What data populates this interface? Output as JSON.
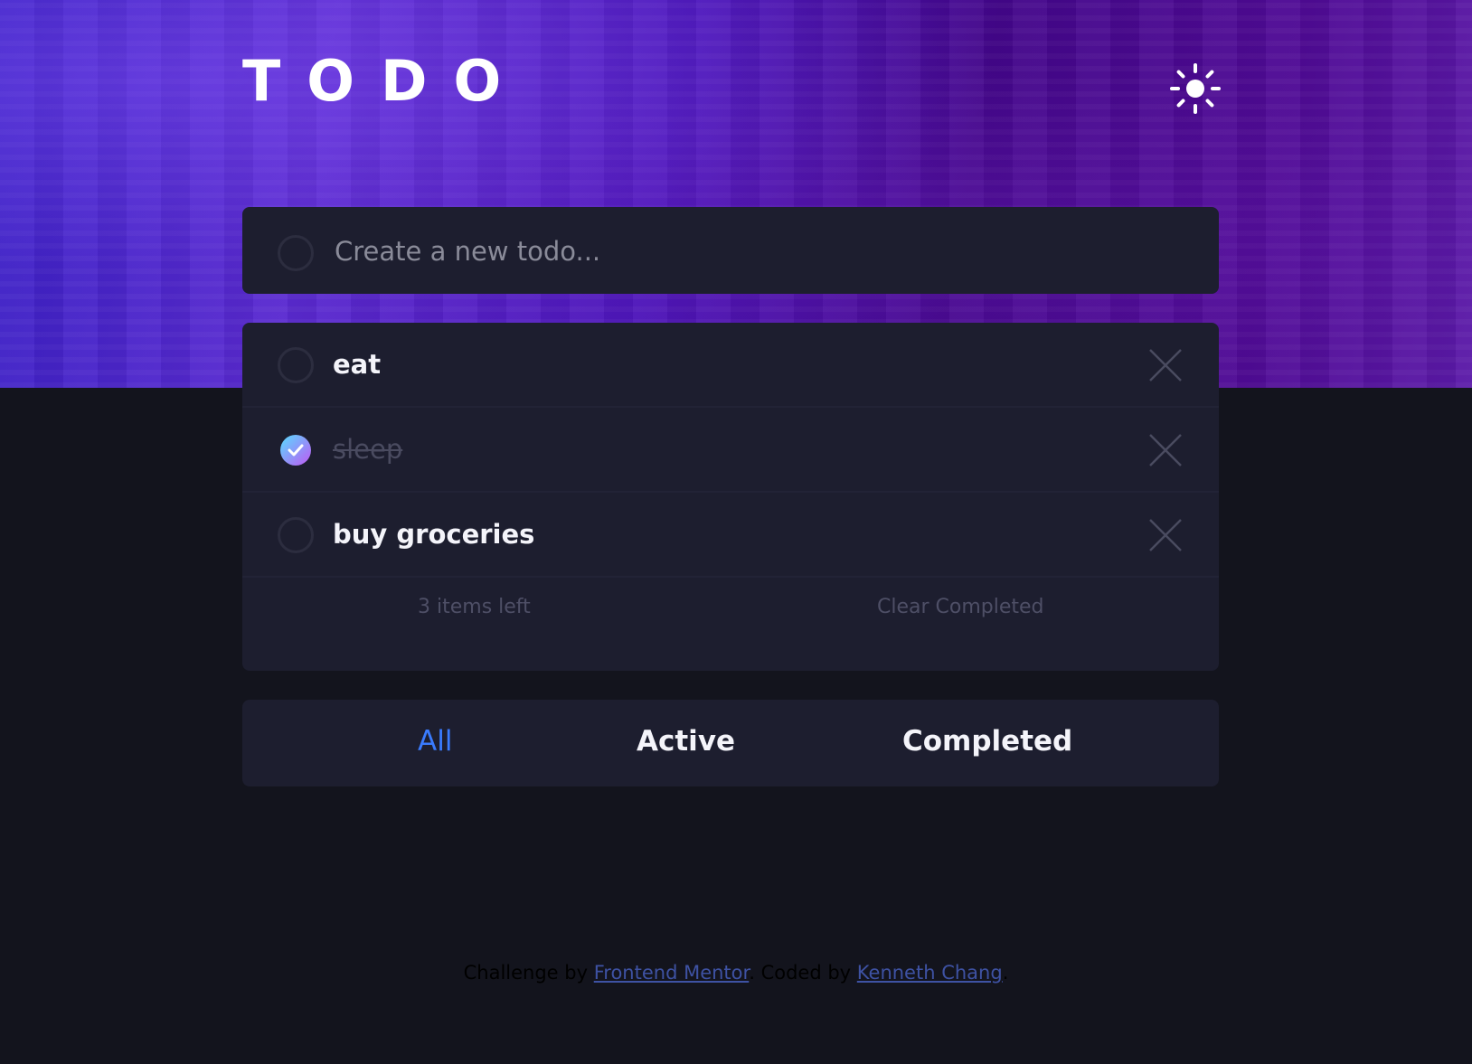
{
  "app": {
    "title": "TODO"
  },
  "theme": {
    "icon": "sun-icon"
  },
  "new_todo": {
    "placeholder": "Create a new todo...",
    "value": ""
  },
  "todos": [
    {
      "text": "eat",
      "completed": false
    },
    {
      "text": "sleep",
      "completed": true
    },
    {
      "text": "buy groceries",
      "completed": false
    }
  ],
  "list_footer": {
    "items_left": "3 items left",
    "clear_label": "Clear Completed"
  },
  "filters": {
    "all": "All",
    "active": "Active",
    "completed": "Completed",
    "selected": "All"
  },
  "attribution": {
    "prefix": "Challenge by",
    "link1": "Frontend Mentor",
    "middle": ". Coded by",
    "link2": "Kenneth Chang",
    "suffix": "."
  },
  "colors": {
    "accent": "#3a7bfd",
    "card": "#1d1e2f",
    "background": "#13141d",
    "check_gradient_start": "#57ddff",
    "check_gradient_end": "#c058f3"
  }
}
